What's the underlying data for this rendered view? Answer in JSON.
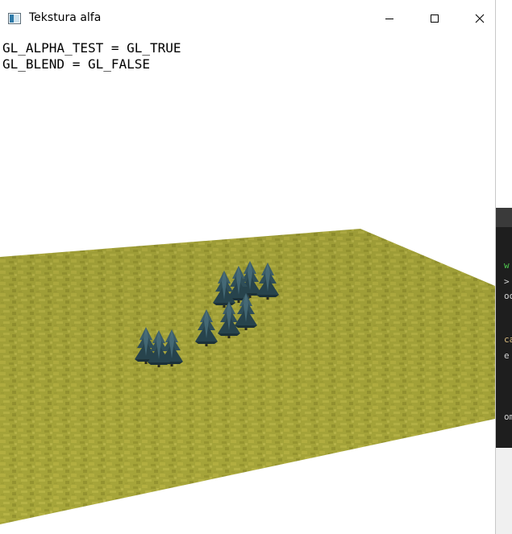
{
  "window": {
    "title": "Tekstura alfa",
    "controls": {
      "minimize": "minimize",
      "maximize": "maximize",
      "close": "close"
    }
  },
  "viewport": {
    "status_lines": [
      "GL_ALPHA_TEST = GL_TRUE",
      "GL_BLEND = GL_FALSE"
    ],
    "scene": {
      "ground_texture": "grass",
      "ground_color": "#a7a63a",
      "tree_count": 10,
      "tree_color": "#2f4e58"
    }
  },
  "background_window": {
    "fragments": [
      "w",
      ">",
      "oo",
      "",
      "ca",
      "e",
      "om"
    ],
    "fragment_colors": [
      "#4ec94e",
      "#d4d4d4",
      "#d4d4d4",
      "#d4d4d4",
      "#d7ba7d",
      "#d4d4d4",
      "#d4d4d4"
    ]
  }
}
